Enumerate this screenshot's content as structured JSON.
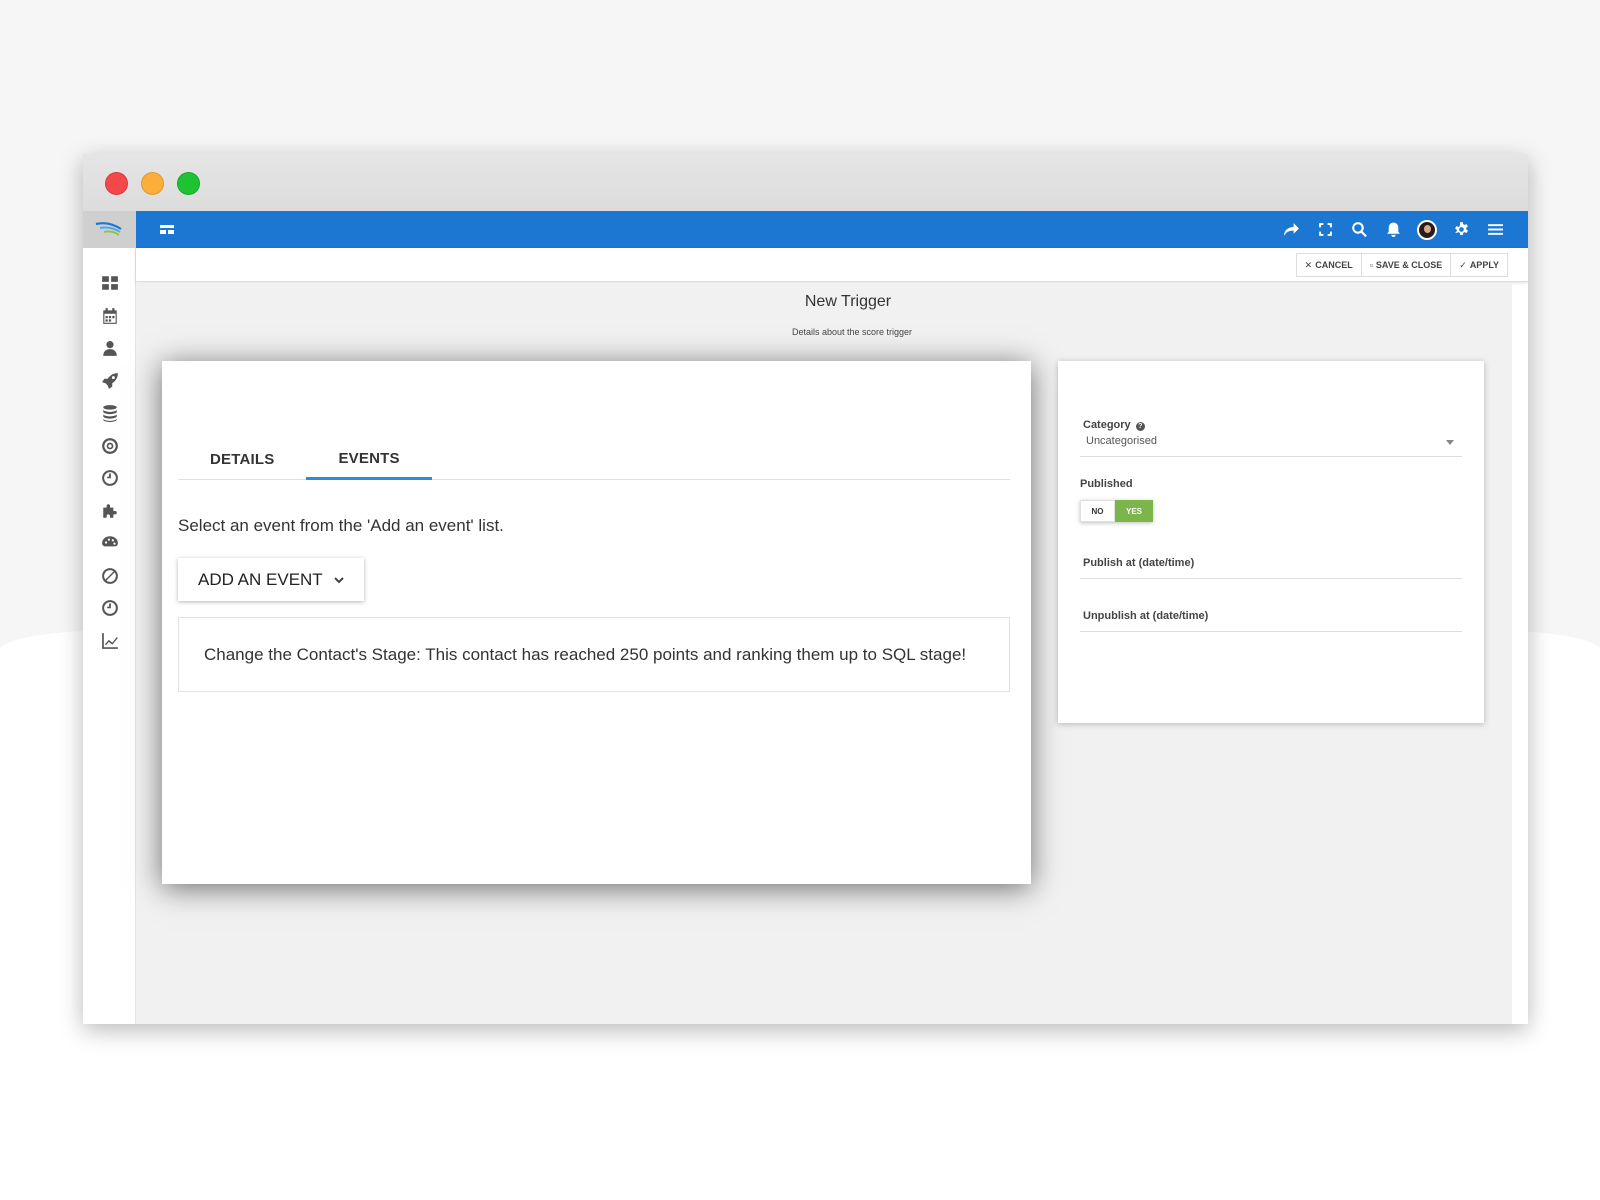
{
  "toolbar": {
    "cancel_label": "CANCEL",
    "save_close_label": "SAVE & CLOSE",
    "apply_label": "APPLY"
  },
  "page": {
    "title": "New Trigger",
    "subtitle": "Details about the score trigger"
  },
  "tabs": [
    {
      "label": "DETAILS",
      "active": false
    },
    {
      "label": "EVENTS",
      "active": true
    }
  ],
  "events": {
    "hint": "Select an event from the 'Add an event' list.",
    "add_button_label": "ADD AN EVENT",
    "items": [
      {
        "text": "Change the Contact's Stage: This contact has reached 250 points and ranking them up to SQL stage!"
      }
    ]
  },
  "side_panel": {
    "category_label": "Category",
    "category_value": "Uncategorised",
    "published_label": "Published",
    "published_no": "NO",
    "published_yes": "YES",
    "published_value": "YES",
    "publish_at_label": "Publish at (date/time)",
    "unpublish_at_label": "Unpublish at (date/time)"
  },
  "colors": {
    "topbar": "#1b77d2",
    "tab_active": "#2d8ae0",
    "toggle_yes": "#7cb64a"
  },
  "icons": {
    "sidebar": [
      "dashboard-icon",
      "calendar-icon",
      "user-icon",
      "rocket-icon",
      "database-icon",
      "target-icon",
      "clock-icon",
      "puzzle-icon",
      "palette-icon",
      "ban-icon",
      "history-icon",
      "chart-line-icon"
    ],
    "topbar": [
      "share-icon",
      "fullscreen-icon",
      "search-icon",
      "bell-icon",
      "avatar",
      "gear-icon",
      "menu-icon"
    ]
  }
}
